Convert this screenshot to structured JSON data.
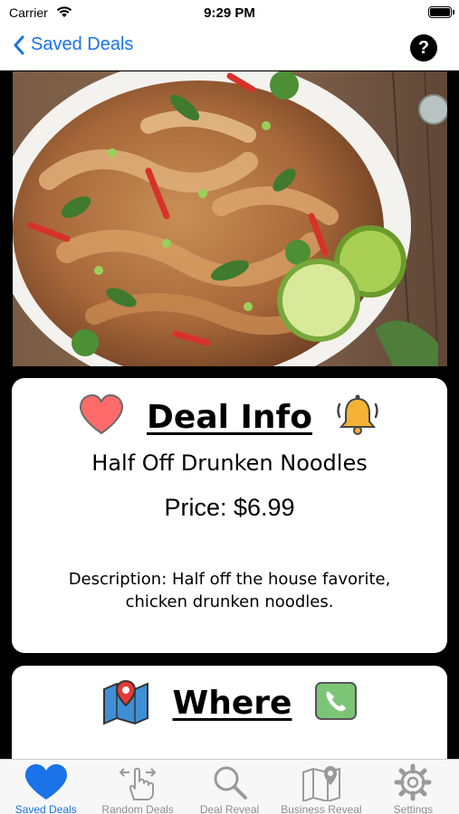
{
  "status_bar": {
    "carrier": "Carrier",
    "time": "9:29 PM"
  },
  "nav": {
    "back_label": "Saved Deals",
    "help_label": "?"
  },
  "deal_card": {
    "title": "Deal Info",
    "deal_name": "Half Off Drunken Noodles",
    "price": "Price: $6.99",
    "description": "Description: Half off the house favorite, chicken drunken noodles.",
    "icons": [
      "heart-icon",
      "bell-icon"
    ]
  },
  "where_card": {
    "title": "Where",
    "icons": [
      "map-pin-icon",
      "phone-icon"
    ]
  },
  "tabs": [
    {
      "label": "Saved Deals",
      "icon": "heart-icon",
      "active": true
    },
    {
      "label": "Random Deals",
      "icon": "tap-hand-icon",
      "active": false
    },
    {
      "label": "Deal Reveal",
      "icon": "magnifier-icon",
      "active": false
    },
    {
      "label": "Business Reveal",
      "icon": "map-pin-icon",
      "active": false
    },
    {
      "label": "Settings",
      "icon": "gear-icon",
      "active": false
    }
  ],
  "colors": {
    "accent": "#1a73e8",
    "heart": "#ff6b6b",
    "bell": "#f5b335",
    "phone": "#7cc576"
  }
}
